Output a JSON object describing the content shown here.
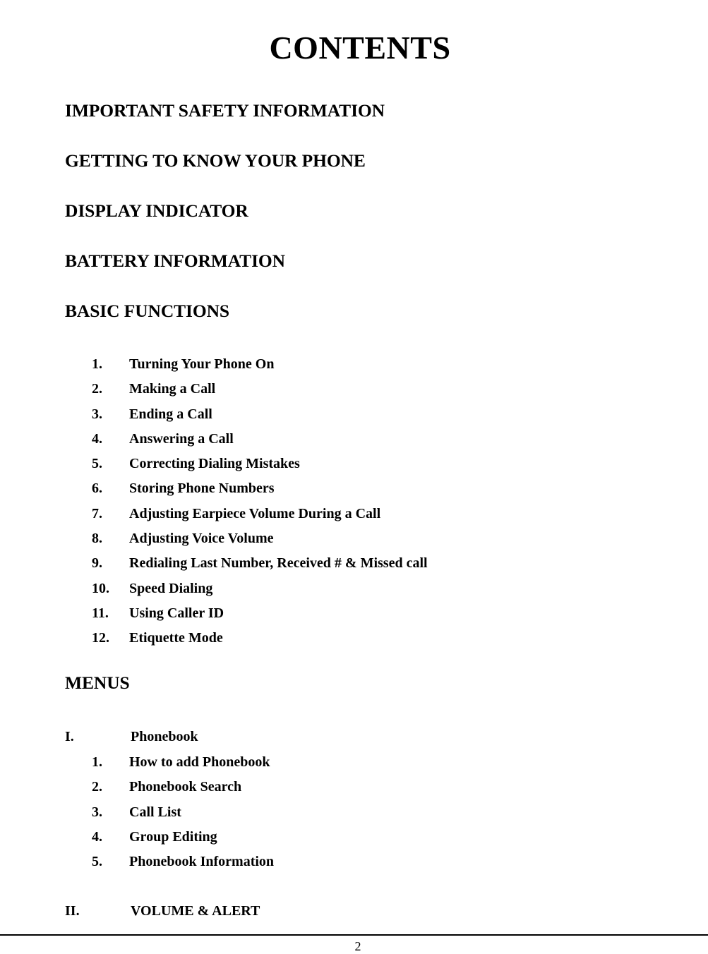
{
  "document": {
    "title": "CONTENTS",
    "page_number": "2"
  },
  "major_headings": [
    {
      "label": "IMPORTANT SAFETY INFORMATION"
    },
    {
      "label": "GETTING TO KNOW YOUR PHONE"
    },
    {
      "label": "DISPLAY INDICATOR"
    },
    {
      "label": "BATTERY INFORMATION"
    },
    {
      "label": "BASIC FUNCTIONS"
    }
  ],
  "basic_functions": {
    "items": [
      {
        "marker": "1.",
        "label": "Turning Your Phone On"
      },
      {
        "marker": "2.",
        "label": "Making a Call"
      },
      {
        "marker": "3.",
        "label": "Ending a Call"
      },
      {
        "marker": "4.",
        "label": "Answering a Call"
      },
      {
        "marker": "5.",
        "label": "Correcting Dialing Mistakes"
      },
      {
        "marker": "6.",
        "label": "Storing Phone Numbers"
      },
      {
        "marker": "7.",
        "label": "Adjusting Earpiece Volume During a Call"
      },
      {
        "marker": "8.",
        "label": "Adjusting Voice Volume"
      },
      {
        "marker": "9.",
        "label": "Redialing Last Number, Received # & Missed call"
      },
      {
        "marker": "10.",
        "label": "Speed Dialing"
      },
      {
        "marker": "11.",
        "label": "Using Caller ID"
      },
      {
        "marker": "12.",
        "label": "Etiquette Mode"
      }
    ]
  },
  "menus": {
    "heading": "MENUS",
    "sections": [
      {
        "marker": "I.",
        "label": "Phonebook"
      },
      {
        "marker": "II.",
        "label": "VOLUME & ALERT"
      }
    ]
  },
  "phonebook": {
    "items": [
      {
        "marker": "1.",
        "label": "How to add Phonebook"
      },
      {
        "marker": "2.",
        "label": "Phonebook Search"
      },
      {
        "marker": "3.",
        "label": "Call List"
      },
      {
        "marker": "4.",
        "label": "Group Editing"
      },
      {
        "marker": "5.",
        "label": "Phonebook Information"
      }
    ]
  }
}
